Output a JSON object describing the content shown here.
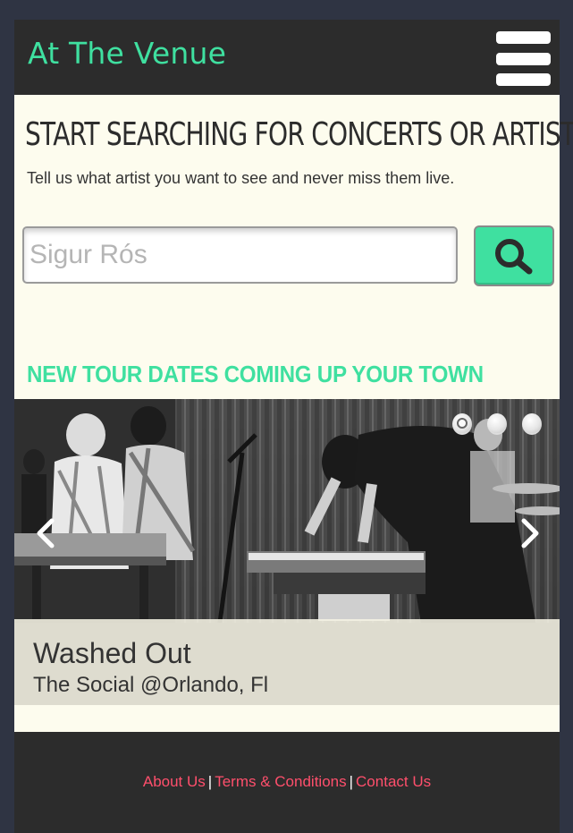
{
  "header": {
    "brand": "At The Venue",
    "menu_icon": "hamburger-icon"
  },
  "hero": {
    "headline": "Start Searching For Concerts or Artists",
    "tagline": "Tell us what artist you want to see and never miss them live."
  },
  "search": {
    "placeholder": "Sigur Rós",
    "value": "",
    "button_icon": "search-icon"
  },
  "tour": {
    "section_title": "NEW TOUR DATES COMING UP YOUR TOWN",
    "carousel": {
      "active_index": 0,
      "slide_count": 3,
      "slide_title": "Washed Out",
      "slide_subtitle": "The Social @Orlando, Fl",
      "prev_icon": "chevron-left-icon",
      "next_icon": "chevron-right-icon"
    }
  },
  "footer": {
    "links": [
      "About Us",
      "Terms & Conditions",
      "Contact Us"
    ],
    "separator": "|"
  },
  "colors": {
    "accent": "#3fe0a0",
    "dark": "#2c2c2c",
    "page_bg": "#fdfcee",
    "link": "#ff4f6c"
  }
}
